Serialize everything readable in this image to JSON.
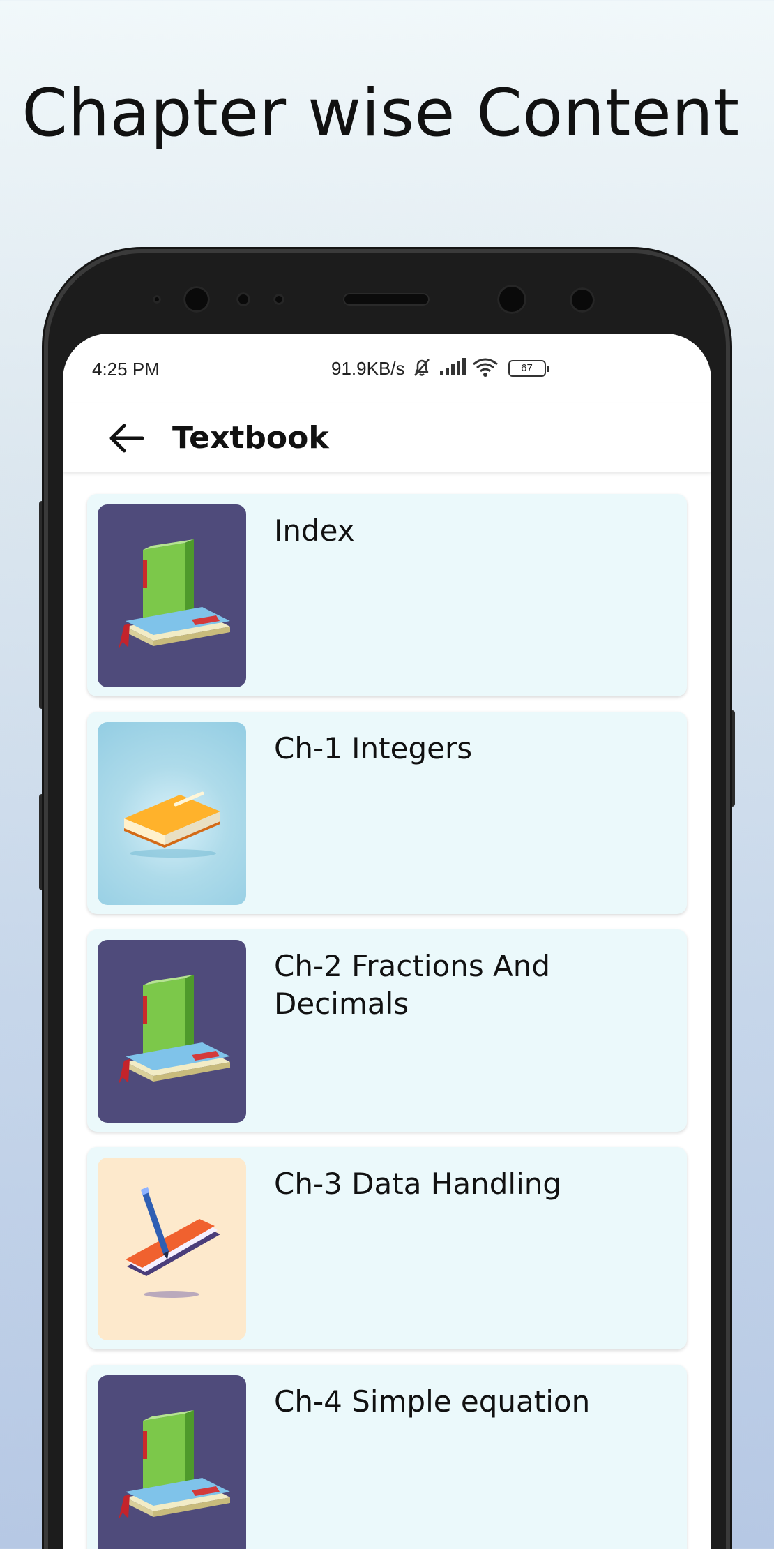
{
  "promo": {
    "title": "Chapter wise Content"
  },
  "status_bar": {
    "time": "4:25 PM",
    "network_speed": "91.9KB/s",
    "battery": "67"
  },
  "app_bar": {
    "title": "Textbook"
  },
  "chapters": [
    {
      "title": "Index",
      "thumbnail": "green-book-stack-icon"
    },
    {
      "title": "Ch-1 Integers",
      "thumbnail": "orange-book-icon"
    },
    {
      "title": "Ch-2 Fractions And Decimals",
      "thumbnail": "green-book-stack-icon"
    },
    {
      "title": "Ch-3 Data Handling",
      "thumbnail": "notebook-pen-icon"
    },
    {
      "title": "Ch-4 Simple equation",
      "thumbnail": "green-book-stack-icon"
    }
  ],
  "colors": {
    "card_bg": "#ebf9fb",
    "thumb_purple": "#4f4b7b",
    "thumb_cream": "#fde9cc",
    "thumb_sky": "#aedbea"
  }
}
